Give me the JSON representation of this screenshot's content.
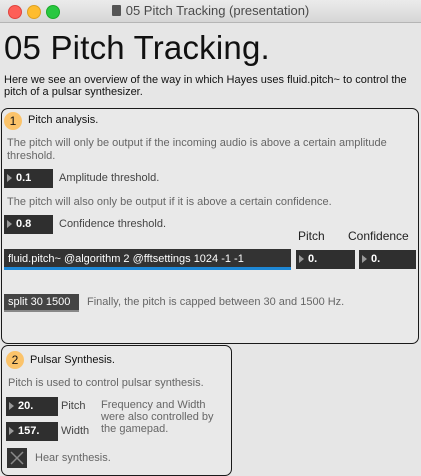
{
  "window": {
    "title": "05 Pitch Tracking (presentation)"
  },
  "page": {
    "title": "05 Pitch Tracking.",
    "intro": "Here we see an overview of the way in which Hayes uses fluid.pitch~ to control the pitch of a pulsar synthesizer."
  },
  "pitch_analysis": {
    "badge": "1",
    "heading": "Pitch analysis.",
    "amp_comment": "The pitch will only be output if the incoming audio is above a certain amplitude threshold.",
    "amp_value": "0.1",
    "amp_label": "Amplitude threshold.",
    "conf_comment": "The pitch will also only be output if it is above a certain confidence.",
    "conf_value": "0.8",
    "conf_label": "Confidence threshold.",
    "pitch_header": "Pitch",
    "confidence_header": "Confidence",
    "object_text": "fluid.pitch~ @algorithm 2 @fftsettings 1024 -1 -1",
    "pitch_out": "0.",
    "confidence_out": "0.",
    "split_text": "split 30 1500",
    "split_comment": "Finally, the pitch is capped between 30 and 1500 Hz."
  },
  "pulsar": {
    "badge": "2",
    "heading": "Pulsar Synthesis.",
    "comment": "Pitch is used to control pulsar synthesis.",
    "pitch_value": "20.",
    "pitch_label": "Pitch",
    "width_value": "157.",
    "width_label": "Width",
    "description": "Frequency and Width were also controlled by the gamepad.",
    "hear_label": "Hear synthesis."
  }
}
